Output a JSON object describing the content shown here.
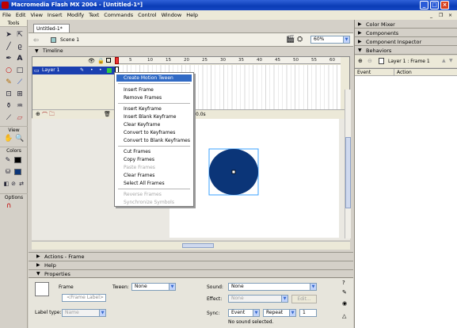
{
  "window": {
    "title": "Macromedia Flash MX 2004 - [Untitled-1*]"
  },
  "menubar": [
    "File",
    "Edit",
    "View",
    "Insert",
    "Modify",
    "Text",
    "Commands",
    "Control",
    "Window",
    "Help"
  ],
  "tools_panel": {
    "header": "Tools",
    "view_label": "View",
    "colors_label": "Colors",
    "options_label": "Options"
  },
  "document": {
    "tab_title": "Untitled-1*",
    "scene": "Scene 1",
    "zoom": "60%",
    "timeline_label": "Timeline",
    "layer_name": "Layer 1",
    "ruler_ticks": [
      "5",
      "10",
      "15",
      "20",
      "25",
      "30",
      "35",
      "40",
      "45",
      "50",
      "55",
      "60",
      "65"
    ],
    "elapsed": "0.0s"
  },
  "context_menu": {
    "items": [
      {
        "label": "Create Motion Tween",
        "state": "highlighted"
      },
      {
        "label": "Insert Frame"
      },
      {
        "label": "Remove Frames"
      },
      {
        "label": "Insert Keyframe"
      },
      {
        "label": "Insert Blank Keyframe"
      },
      {
        "label": "Clear Keyframe"
      },
      {
        "label": "Convert to Keyframes"
      },
      {
        "label": "Convert to Blank Keyframes"
      },
      {
        "label": "Cut Frames"
      },
      {
        "label": "Copy Frames"
      },
      {
        "label": "Paste Frames",
        "state": "disabled"
      },
      {
        "label": "Clear Frames"
      },
      {
        "label": "Select All Frames"
      },
      {
        "label": "Reverse Frames",
        "state": "disabled"
      },
      {
        "label": "Synchronize Symbols",
        "state": "disabled"
      }
    ]
  },
  "right_panels": {
    "color_mixer": "Color Mixer",
    "components": "Components",
    "component_inspector": "Component Inspector",
    "behaviors": "Behaviors",
    "behaviors_target": "Layer 1 : Frame 1",
    "col_event": "Event",
    "col_action": "Action"
  },
  "bottom_panels": {
    "actions": "Actions - Frame",
    "help": "Help",
    "properties": "Properties"
  },
  "properties": {
    "type": "Frame",
    "frame_label_placeholder": "<Frame Label>",
    "label_type_label": "Label type:",
    "label_type_value": "Name",
    "tween_label": "Tween:",
    "tween_value": "None",
    "sound_label": "Sound:",
    "sound_value": "None",
    "effect_label": "Effect:",
    "effect_value": "None",
    "edit_button": "Edit...",
    "sync_label": "Sync:",
    "sync_value": "Event",
    "repeat_value": "Repeat",
    "repeat_count": "1",
    "sound_status": "No sound selected."
  },
  "colors": {
    "title_bar": "#0a3cb6",
    "selection": "#316ac5",
    "circle_fill": "#0b3578",
    "circle_stroke": "#3aa0ff"
  }
}
